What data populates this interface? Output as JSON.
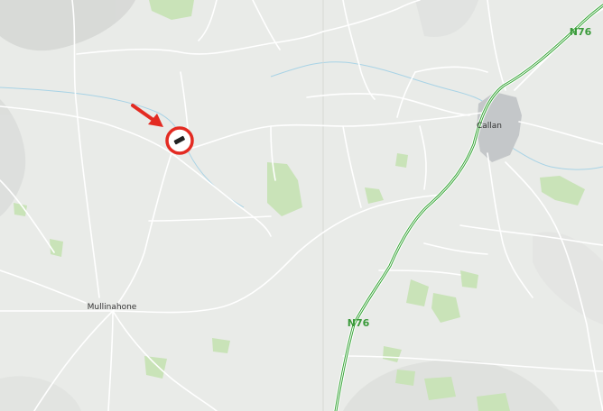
{
  "map": {
    "places": [
      {
        "id": "callan",
        "name": "Callan"
      },
      {
        "id": "mullinahone",
        "name": "Mullinahone"
      }
    ],
    "roads": [
      {
        "id": "n76-north",
        "label": "N76"
      },
      {
        "id": "n76-south",
        "label": "N76"
      }
    ],
    "marker": {
      "type": "circled-location",
      "color": "#e32b22"
    },
    "colors": {
      "land": "#e9ebe8",
      "minor_road": "#ffffff",
      "national_road": "#3aa63a",
      "national_road_casing": "#ffffff",
      "water": "#a8d3e6",
      "woodland": "#c9e3b8",
      "urban": "#c4c7c9",
      "hill_shade": "#d2d4d1",
      "marker": "#e32b22"
    }
  }
}
